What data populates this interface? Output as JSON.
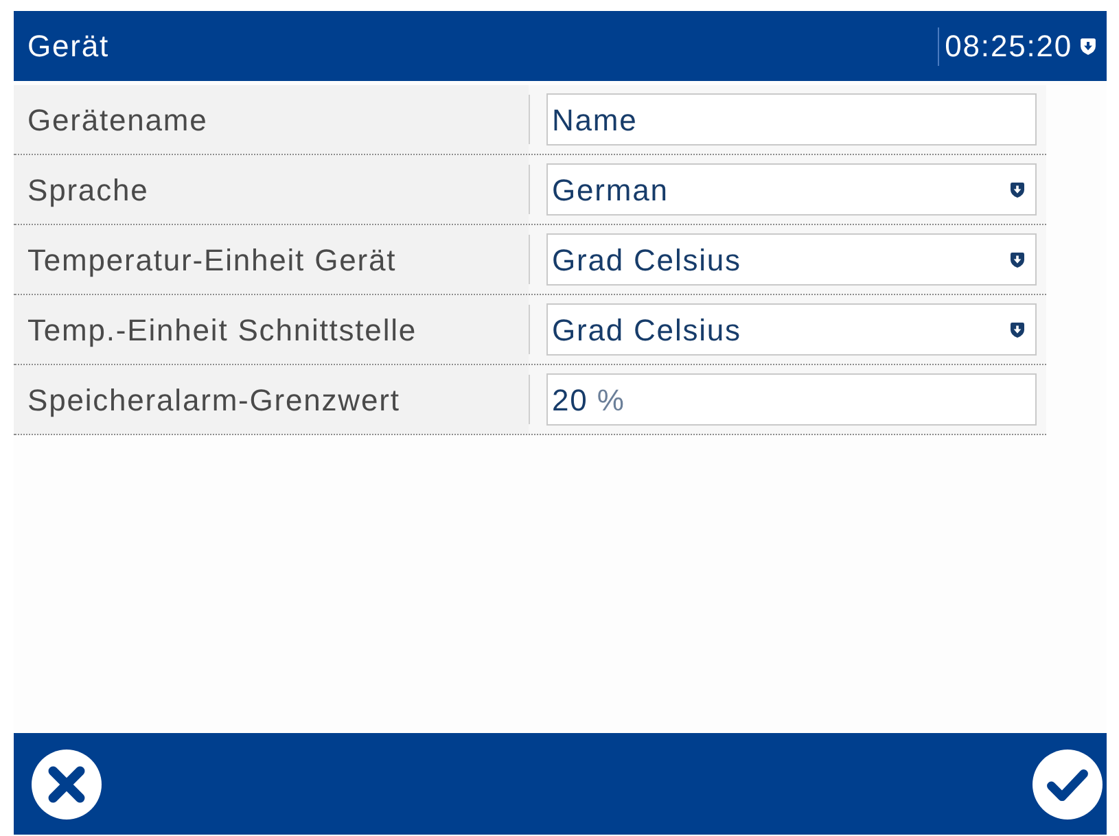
{
  "window": {
    "title": "Gerät",
    "clock": "08:25:20"
  },
  "settings": [
    {
      "label": "Gerätename",
      "kind": "text",
      "value": "Name"
    },
    {
      "label": "Sprache",
      "kind": "dropdown",
      "value": "German"
    },
    {
      "label": "Temperatur-Einheit Gerät",
      "kind": "dropdown",
      "value": "Grad Celsius"
    },
    {
      "label": "Temp.-Einheit Schnittstelle",
      "kind": "dropdown",
      "value": "Grad Celsius"
    },
    {
      "label": "Speicheralarm-Grenzwert",
      "kind": "text",
      "value": "20",
      "unit": "%"
    }
  ]
}
